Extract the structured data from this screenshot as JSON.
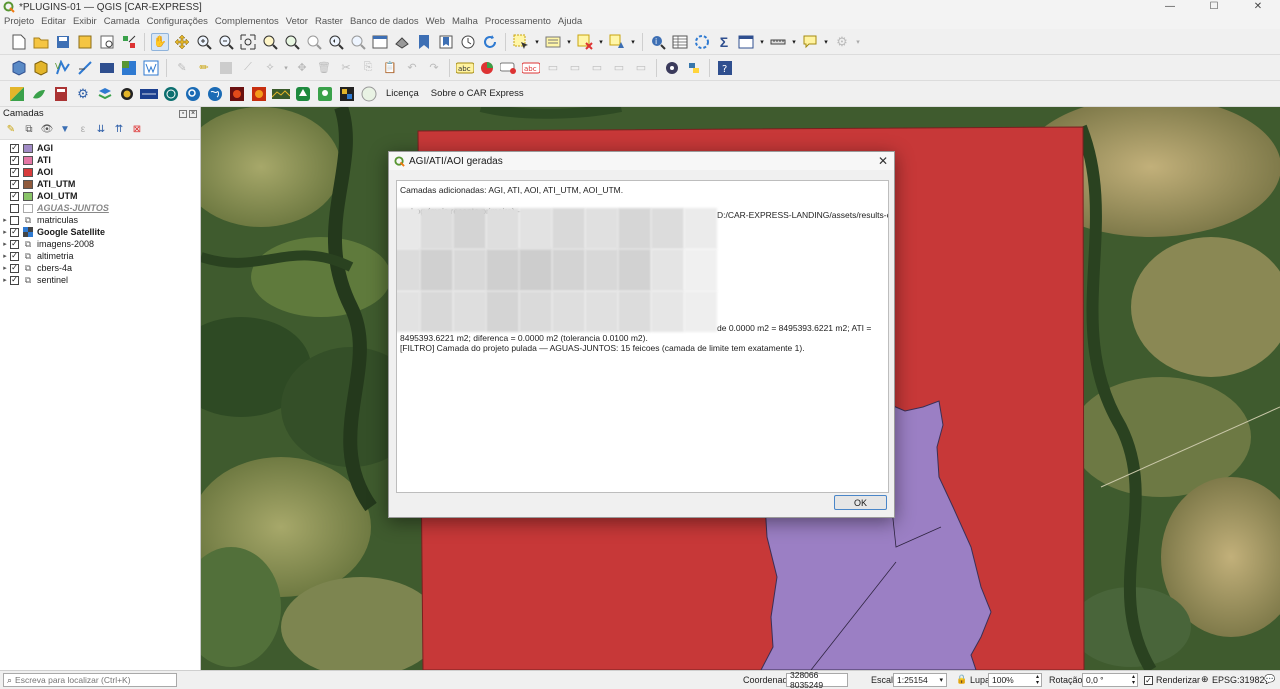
{
  "window": {
    "title": "*PLUGINS-01 — QGIS [CAR-EXPRESS]",
    "minimize": "—",
    "maximize": "☐",
    "close": "✕"
  },
  "menu": [
    "Projeto",
    "Editar",
    "Exibir",
    "Camada",
    "Configurações",
    "Complementos",
    "Vetor",
    "Raster",
    "Banco de dados",
    "Web",
    "Malha",
    "Processamento",
    "Ajuda"
  ],
  "toolbar3": {
    "licenca": "Licença",
    "sobre": "Sobre o CAR Express"
  },
  "layers_panel": {
    "title": "Camadas",
    "layers": [
      {
        "name": "AGI",
        "checked": true,
        "swatch": "#a18bc6",
        "bold": true,
        "type": "vector"
      },
      {
        "name": "ATI",
        "checked": true,
        "swatch": "#e477a5",
        "bold": true,
        "type": "vector"
      },
      {
        "name": "AOI",
        "checked": true,
        "swatch": "#d83b3b",
        "bold": true,
        "type": "vector"
      },
      {
        "name": "ATI_UTM",
        "checked": true,
        "swatch": "#8f5a3c",
        "bold": true,
        "type": "vector"
      },
      {
        "name": "AOI_UTM",
        "checked": true,
        "swatch": "#89c468",
        "bold": true,
        "type": "vector"
      },
      {
        "name": "AGUAS-JUNTOS",
        "checked": false,
        "swatch": "#ffffff",
        "bold": false,
        "type": "vector-dim"
      },
      {
        "name": "matriculas",
        "checked": false,
        "bold": false,
        "type": "group"
      },
      {
        "name": "Google Satellite",
        "checked": true,
        "bold": true,
        "type": "raster"
      },
      {
        "name": "imagens-2008",
        "checked": true,
        "bold": false,
        "type": "group"
      },
      {
        "name": "altimetria",
        "checked": true,
        "bold": false,
        "type": "group"
      },
      {
        "name": "cbers-4a",
        "checked": true,
        "bold": false,
        "type": "group"
      },
      {
        "name": "sentinel",
        "checked": true,
        "bold": false,
        "type": "group"
      }
    ]
  },
  "dialog": {
    "title": "AGI/ATI/AOI geradas",
    "lines": [
      "Camadas adicionadas: AGI, ATI, AOI, ATI_UTM, AOI_UTM.",
      "",
      "--- Log (mais recente primeiro) ---"
    ],
    "line_right_path": "D:/CAR-EXPRESS-LANDING/assets/results-car/agi-",
    "line_right_area": "de 0.0000 m2 = 8495393.6221 m2; ATI =",
    "line_area": "8495393.6221 m2; diferenca = 0.0000 m2 (tolerancia 0.0100 m2).",
    "line_filter": "[FILTRO] Camada do projeto pulada — AGUAS-JUNTOS: 15 feicoes (camada de limite tem exatamente 1).",
    "ok_label": "OK"
  },
  "statusbar": {
    "search_placeholder": "Escreva para localizar (Ctrl+K)",
    "coord_label": "Coordenada",
    "coord_value": "328066  8035249",
    "scale_label": "Escala",
    "scale_value": "1:25154",
    "lupa_label": "Lupa",
    "lupa_value": "100%",
    "rotation_label": "Rotação",
    "rotation_value": "0,0 °",
    "render_label": "Renderizar",
    "crs": "EPSG:31982"
  },
  "colors": {
    "aoi_red": "#c73838",
    "agi_purple": "#9b7fc4",
    "qgis_green": "#589632",
    "accent_blue": "#4a86c8"
  }
}
